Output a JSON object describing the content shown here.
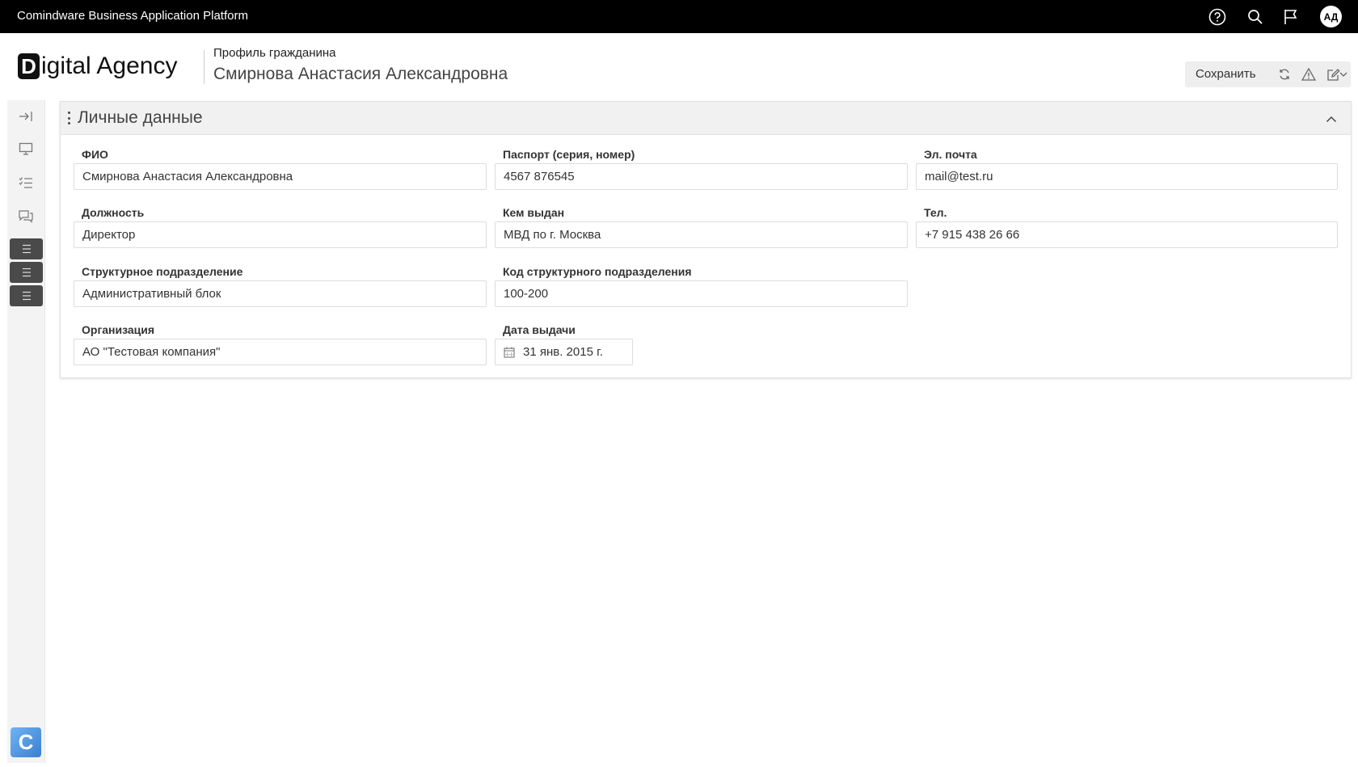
{
  "topbar": {
    "title": "Comindware Business Application Platform",
    "icons": [
      "help-icon",
      "search-icon",
      "flag-icon"
    ],
    "avatar_initials": "АД"
  },
  "header": {
    "logo_letter": "D",
    "logo_text": "igital Agency",
    "subtitle": "Профиль гражданина",
    "title": "Смирнова Анастасия Александровна"
  },
  "toolbar": {
    "save_label": "Сохранить",
    "icons": [
      "refresh-icon",
      "warning-icon",
      "edit-icon",
      "chevron-down-icon"
    ]
  },
  "sidebar": {
    "icons": [
      "collapse-sidebar-icon",
      "desktop-icon",
      "tasks-icon",
      "chat-icon"
    ],
    "menu_buttons": [
      "menu-icon",
      "menu-icon",
      "menu-icon"
    ],
    "bottom_logo": "C"
  },
  "panel": {
    "title": "Личные данные",
    "fields": {
      "fio": {
        "label": "ФИО",
        "value": "Смирнова Анастасия Александровна"
      },
      "position": {
        "label": "Должность",
        "value": "Директор"
      },
      "department": {
        "label": "Структурное подразделение",
        "value": "Административный блок"
      },
      "organization": {
        "label": "Организация",
        "value": "АО \"Тестовая компания\""
      },
      "passport": {
        "label": "Паспорт (серия, номер)",
        "value": "4567 876545"
      },
      "issued_by": {
        "label": "Кем выдан",
        "value": "МВД по г. Москва"
      },
      "dept_code": {
        "label": "Код структурного подразделения",
        "value": "100-200"
      },
      "issue_date": {
        "label": "Дата выдачи",
        "value": "31 янв. 2015 г."
      },
      "email": {
        "label": "Эл. почта",
        "value": "mail@test.ru"
      },
      "phone": {
        "label": "Тел.",
        "value": "+7 915 438 26 66"
      }
    }
  }
}
